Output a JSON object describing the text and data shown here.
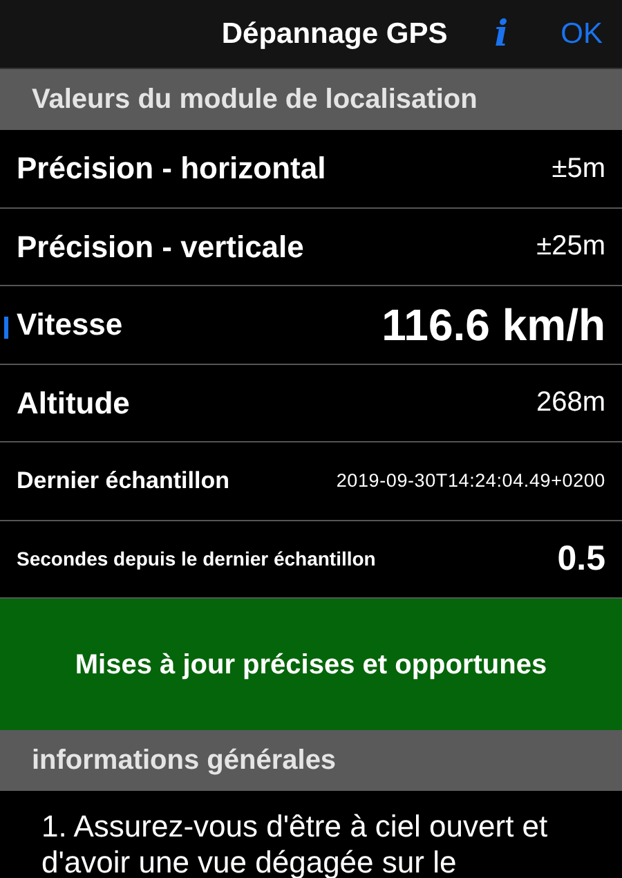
{
  "nav_bar": {
    "title": "Dépannage GPS",
    "info_button": "i",
    "done_button": "OK"
  },
  "sections": [
    {
      "header": "Valeurs du module de localisation",
      "rows": [
        {
          "kind": "standard",
          "label": "Précision - horizontal",
          "value": "±5m",
          "marked": false
        },
        {
          "kind": "standard",
          "label": "Précision - verticale",
          "value": "±25m",
          "marked": false
        },
        {
          "kind": "emphasized",
          "label": "Vitesse",
          "value": "116.6 km/h",
          "marked": true
        },
        {
          "kind": "standard",
          "label": "Altitude",
          "value": "268m",
          "marked": false
        },
        {
          "kind": "timestamp",
          "label": "Dernier échantillon",
          "value": "2019-09-30T14:24:04.49+0200",
          "marked": false
        },
        {
          "kind": "counter",
          "label": "Secondes depuis le dernier échantillon",
          "value": "0.5",
          "marked": false
        }
      ],
      "status_banner": "Mises à jour précises et opportunes"
    },
    {
      "header": "informations générales",
      "text": "1. Assurez-vous d'être à ciel ouvert et d'avoir une vue dégagée sur le"
    }
  ]
}
